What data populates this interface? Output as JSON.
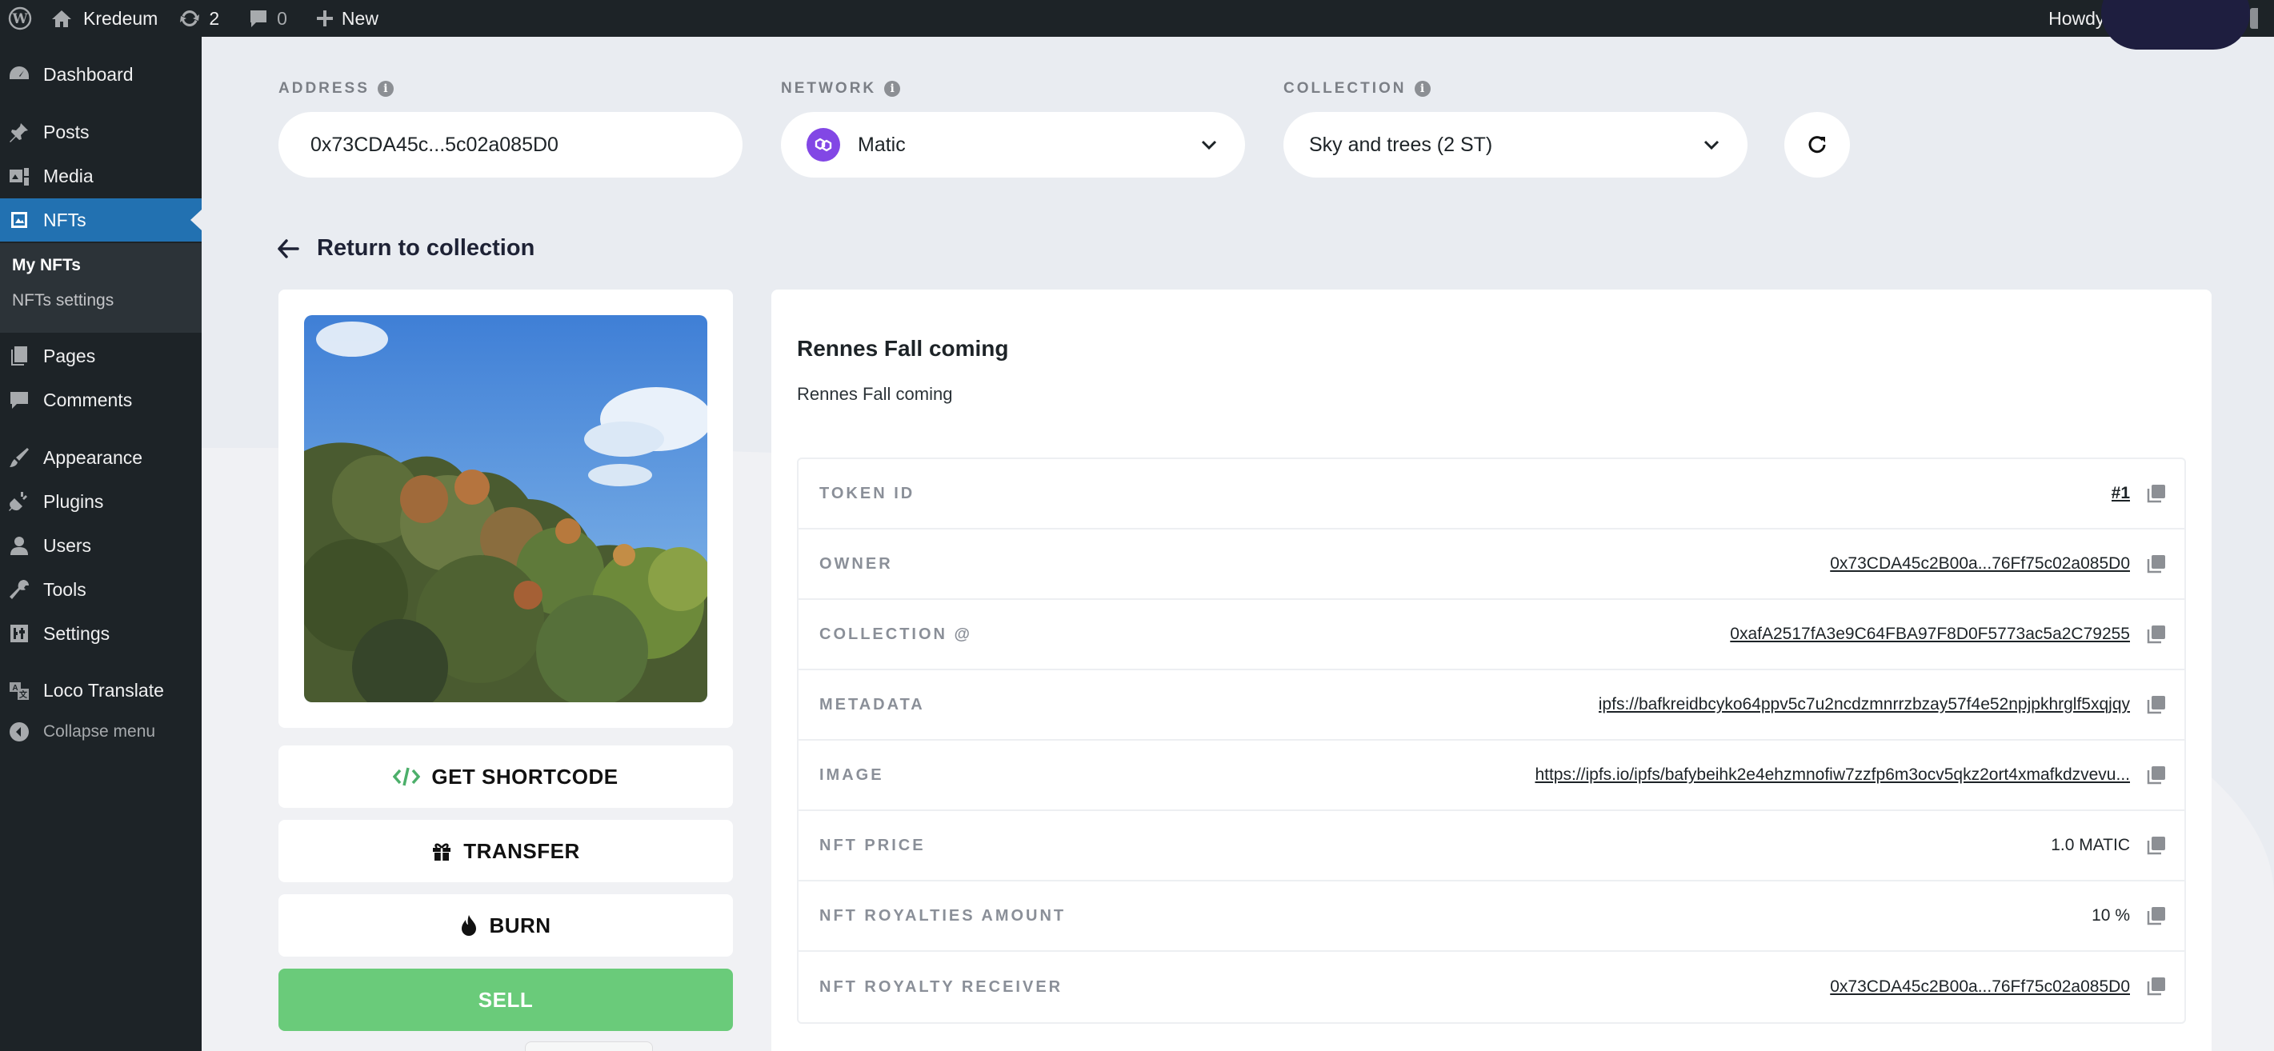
{
  "adminbar": {
    "site_name": "Kredeum",
    "updates_count": "2",
    "comments_count": "0",
    "new_label": "New",
    "howdy": "Howdy, yoann kredeum"
  },
  "sidebar": {
    "items": [
      {
        "label": "Dashboard",
        "icon": "dashboard-icon"
      },
      {
        "label": "Posts",
        "icon": "pin-icon"
      },
      {
        "label": "Media",
        "icon": "media-icon"
      },
      {
        "label": "NFTs",
        "icon": "gallery-icon"
      },
      {
        "label": "Pages",
        "icon": "pages-icon"
      },
      {
        "label": "Comments",
        "icon": "comment-icon"
      },
      {
        "label": "Appearance",
        "icon": "brush-icon"
      },
      {
        "label": "Plugins",
        "icon": "plug-icon"
      },
      {
        "label": "Users",
        "icon": "user-icon"
      },
      {
        "label": "Tools",
        "icon": "wrench-icon"
      },
      {
        "label": "Settings",
        "icon": "sliders-icon"
      },
      {
        "label": "Loco Translate",
        "icon": "translate-icon"
      }
    ],
    "submenu": [
      "My NFTs",
      "NFTs settings"
    ],
    "collapse_label": "Collapse menu"
  },
  "selectors": {
    "address_label": "ADDRESS",
    "address_value": "0x73CDA45c...5c02a085D0",
    "network_label": "NETWORK",
    "network_value": "Matic",
    "collection_label": "COLLECTION",
    "collection_value": "Sky and trees (2 ST)"
  },
  "return_label": "Return to collection",
  "actions": {
    "shortcode": "GET SHORTCODE",
    "transfer": "TRANSFER",
    "burn": "BURN",
    "sell": "SELL"
  },
  "nft": {
    "title": "Rennes Fall coming",
    "description": "Rennes Fall coming",
    "properties": [
      {
        "key": "TOKEN ID",
        "value": "#1"
      },
      {
        "key": "OWNER",
        "value": "0x73CDA45c2B00a...76Ff75c02a085D0"
      },
      {
        "key": "COLLECTION @",
        "value": "0xafA2517fA3e9C64FBA97F8D0F5773ac5a2C79255"
      },
      {
        "key": "METADATA",
        "value": "ipfs://bafkreidbcyko64ppv5c7u2ncdzmnrrzbzay57f4e52npjpkhrglf5xqjqy"
      },
      {
        "key": "IMAGE",
        "value": "https://ipfs.io/ipfs/bafybeihk2e4ehzmnofiw7zzfp6m3ocv5qkz2ort4xmafkdzvevu..."
      },
      {
        "key": "NFT PRICE",
        "value": "1.0 MATIC"
      },
      {
        "key": "NFT ROYALTIES AMOUNT",
        "value": "10 %"
      },
      {
        "key": "NFT ROYALTY RECEIVER",
        "value": "0x73CDA45c2B00a...76Ff75c02a085D0"
      }
    ]
  },
  "colors": {
    "sidebar_bg": "#1d2327",
    "active_menu": "#2271b1",
    "sell_green": "#6acb7a",
    "matic_purple": "#8247e5"
  }
}
